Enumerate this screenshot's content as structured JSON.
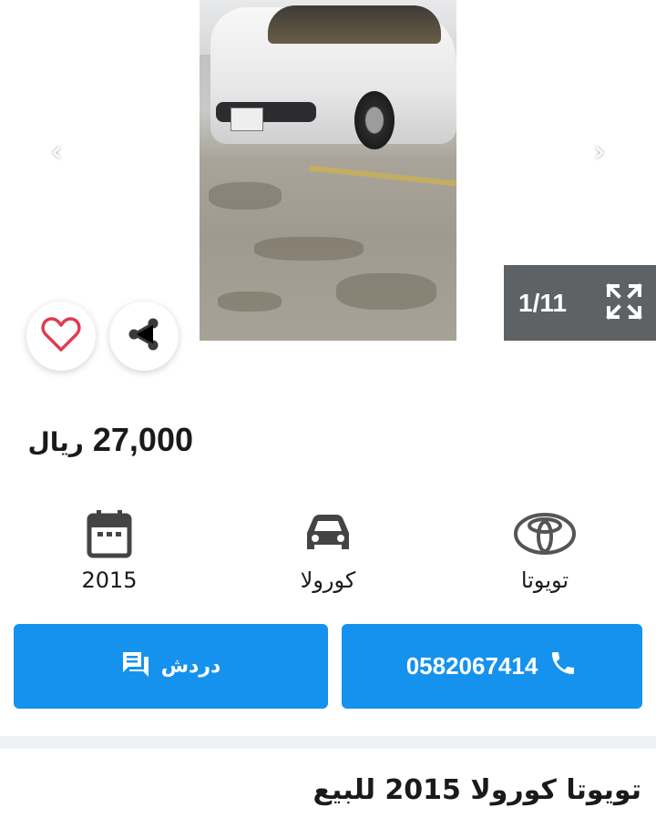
{
  "gallery": {
    "counter": "1/11",
    "icons": {
      "prev": "chevron-left-icon",
      "next": "chevron-right-icon",
      "expand": "fullscreen-icon"
    }
  },
  "actions": {
    "favorite_icon": "heart-icon",
    "share_icon": "share-icon"
  },
  "listing": {
    "price": "27,000",
    "currency": "ريال",
    "title": "تويوتا كورولا 2015 للبيع",
    "specs": {
      "year": "2015",
      "model": "كورولا",
      "make": "تويوتا"
    }
  },
  "buttons": {
    "chat_label": "دردش",
    "phone_label": "0582067414"
  },
  "colors": {
    "accent": "#1592ee",
    "heart": "#e03c4e",
    "counter_bg": "#5f6265"
  }
}
